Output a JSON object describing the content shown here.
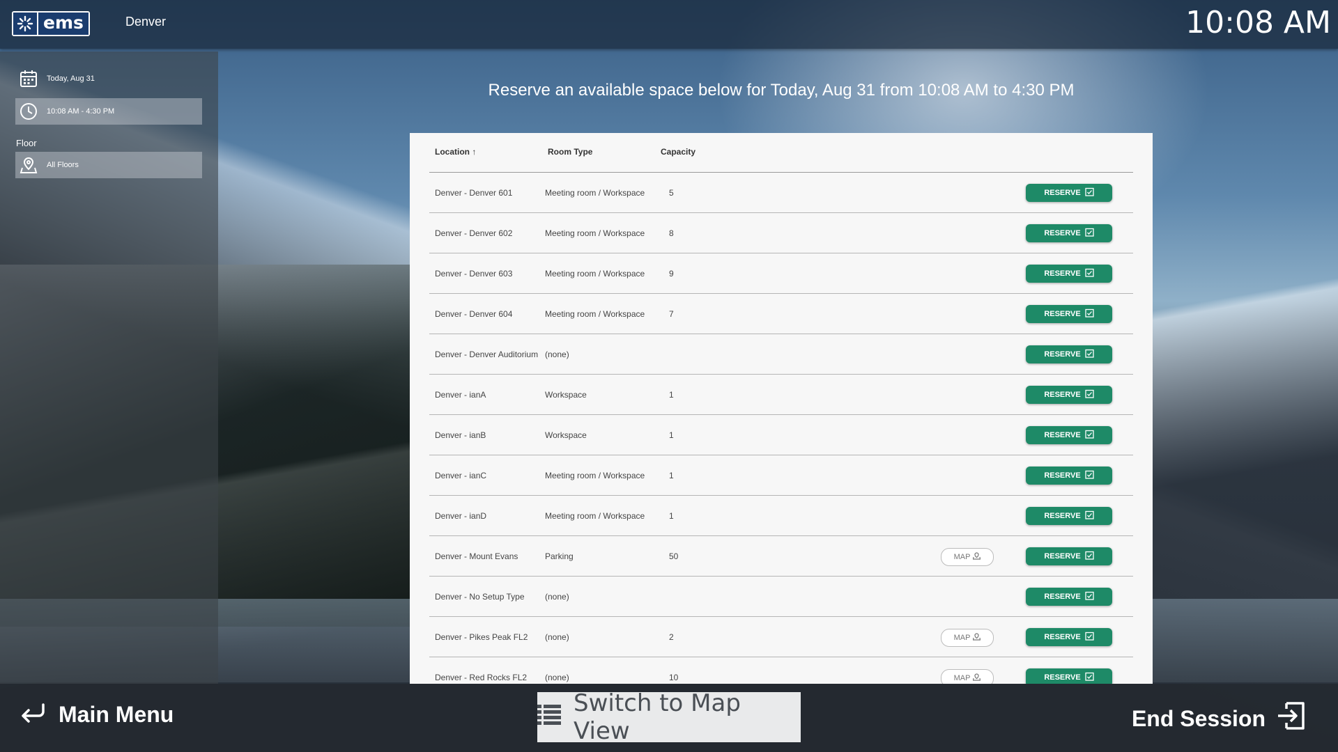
{
  "header": {
    "logo_text": "ems",
    "site": "Denver",
    "clock": "10:08 AM"
  },
  "sidebar": {
    "date": "Today, Aug 31",
    "time_range": "10:08 AM - 4:30 PM",
    "floor_label": "Floor",
    "floor_value": "All Floors"
  },
  "headline": "Reserve an available space below for Today, Aug 31 from 10:08 AM to 4:30 PM",
  "table": {
    "columns": {
      "location": "Location",
      "room_type": "Room Type",
      "capacity": "Capacity"
    },
    "sort_indicator": "↑",
    "reserve_label": "RESERVE",
    "map_label": "MAP",
    "rows": [
      {
        "location": "Denver - Denver 601",
        "room_type": "Meeting room / Workspace",
        "capacity": "5",
        "map": false
      },
      {
        "location": "Denver - Denver 602",
        "room_type": "Meeting room / Workspace",
        "capacity": "8",
        "map": false
      },
      {
        "location": "Denver - Denver 603",
        "room_type": "Meeting room / Workspace",
        "capacity": "9",
        "map": false
      },
      {
        "location": "Denver - Denver 604",
        "room_type": "Meeting room / Workspace",
        "capacity": "7",
        "map": false
      },
      {
        "location": "Denver - Denver Auditorium",
        "room_type": "(none)",
        "capacity": "",
        "map": false
      },
      {
        "location": "Denver - ianA",
        "room_type": "Workspace",
        "capacity": "1",
        "map": false
      },
      {
        "location": "Denver - ianB",
        "room_type": "Workspace",
        "capacity": "1",
        "map": false
      },
      {
        "location": "Denver - ianC",
        "room_type": "Meeting room / Workspace",
        "capacity": "1",
        "map": false
      },
      {
        "location": "Denver - ianD",
        "room_type": "Meeting room / Workspace",
        "capacity": "1",
        "map": false
      },
      {
        "location": "Denver - Mount Evans",
        "room_type": "Parking",
        "capacity": "50",
        "map": true
      },
      {
        "location": "Denver - No Setup Type",
        "room_type": "(none)",
        "capacity": "",
        "map": false
      },
      {
        "location": "Denver - Pikes Peak FL2",
        "room_type": "(none)",
        "capacity": "2",
        "map": true
      },
      {
        "location": "Denver - Red Rocks FL2",
        "room_type": "(none)",
        "capacity": "10",
        "map": true
      }
    ]
  },
  "footer": {
    "main_menu": "Main Menu",
    "switch_view": "Switch to Map View",
    "end_session": "End Session"
  }
}
